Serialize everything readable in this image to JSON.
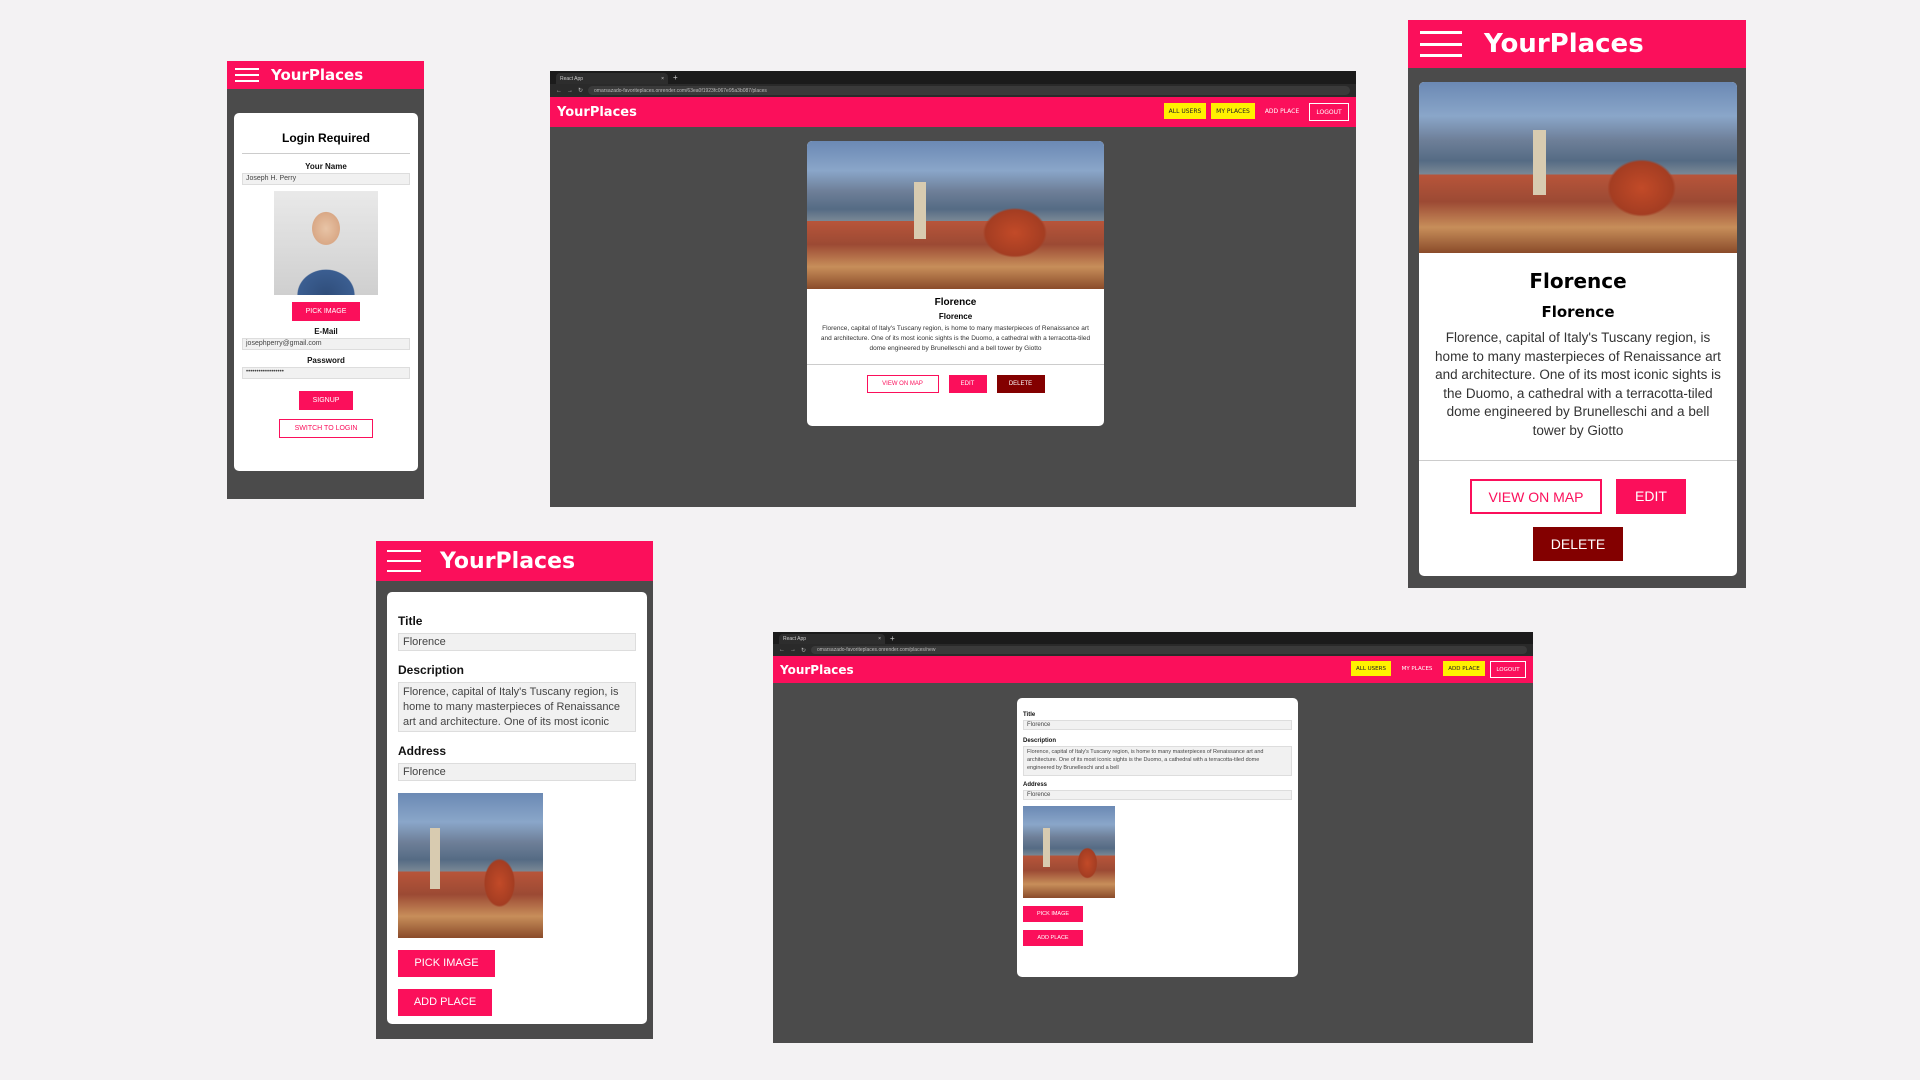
{
  "brand": "YourPlaces",
  "colors": {
    "accent": "#fb0f5b",
    "dark_bg": "#4b4b4b",
    "active_nav": "#fff100",
    "delete": "#830000"
  },
  "login": {
    "title": "Login Required",
    "name_label": "Your Name",
    "name_value": "Joseph H. Perry",
    "pick_image": "PICK IMAGE",
    "email_label": "E-Mail",
    "email_value": "josephperry@gmail.com",
    "password_label": "Password",
    "password_value": "••••••••••••••••••",
    "signup": "SIGNUP",
    "switch": "SWITCH TO LOGIN"
  },
  "browser1": {
    "tab_title": "React App",
    "url": "omarsazado-favoriteplaces.onrender.com/63ea0f1923fc067e95a3b087/places",
    "nav": [
      "ALL USERS",
      "MY PLACES",
      "ADD PLACE",
      "LOGOUT"
    ],
    "place": {
      "title": "Florence",
      "address": "Florence",
      "description": "Florence, capital of Italy's Tuscany region, is home to many masterpieces of Renaissance art and architecture. One of its most iconic sights is the Duomo, a cathedral with a terracotta-tiled dome engineered by Brunelleschi and a bell tower by Giotto",
      "view_on_map": "VIEW ON MAP",
      "edit": "EDIT",
      "delete": "DELETE"
    }
  },
  "mobile_place": {
    "title": "Florence",
    "address": "Florence",
    "description": "Florence, capital of Italy's Tuscany region, is home to many masterpieces of Renaissance art and architecture. One of its most iconic sights is the Duomo, a cathedral with a terracotta-tiled dome engineered by Brunelleschi and a bell tower by Giotto",
    "view_on_map": "VIEW ON MAP",
    "edit": "EDIT",
    "delete": "DELETE"
  },
  "mobile_form": {
    "title_label": "Title",
    "title_value": "Florence",
    "description_label": "Description",
    "description_value": "Florence, capital of Italy's Tuscany region, is home to many masterpieces of Renaissance art and architecture. One of its most iconic",
    "address_label": "Address",
    "address_value": "Florence",
    "pick_image": "PICK IMAGE",
    "add_place": "ADD PLACE"
  },
  "browser2": {
    "tab_title": "React App",
    "url": "omarsazado-favoriteplaces.onrender.com/places/new",
    "nav": [
      "ALL USERS",
      "MY PLACES",
      "ADD PLACE",
      "LOGOUT"
    ],
    "form": {
      "title_label": "Title",
      "title_value": "Florence",
      "description_label": "Description",
      "description_value": "Florence, capital of Italy's Tuscany region, is home to many masterpieces of Renaissance art and architecture. One of its most iconic sights is the Duomo, a cathedral with a terracotta-tiled dome engineered by Brunelleschi and a bell",
      "address_label": "Address",
      "address_value": "Florence",
      "pick_image": "PICK IMAGE",
      "add_place": "ADD PLACE"
    }
  }
}
